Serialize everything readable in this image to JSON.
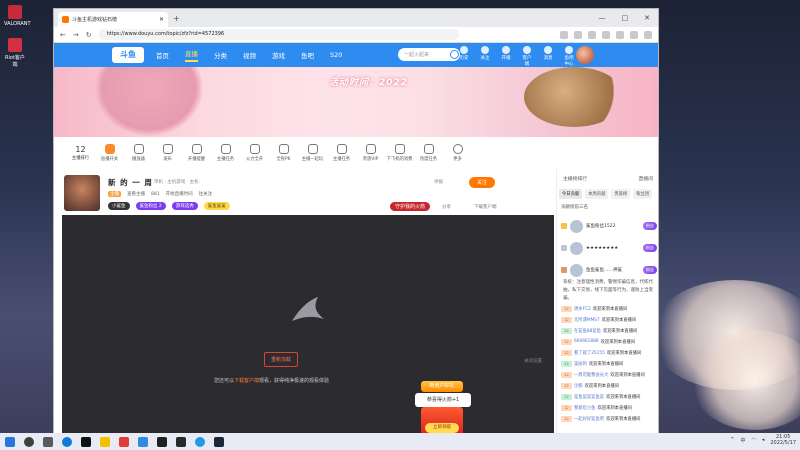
{
  "desktop": {
    "icons": [
      {
        "label": "VALORANT",
        "color": "#c72b3a"
      },
      {
        "label": "Riot客户端",
        "color": "#d23141"
      }
    ]
  },
  "browser": {
    "tab_title": "斗鱼主机游戏钻石榜",
    "url": "https://www.douyu.com/topic/zfz?rid=4572396",
    "window_controls": [
      "—",
      "□",
      "✕"
    ]
  },
  "site": {
    "logo": "斗鱼",
    "nav": [
      "首页",
      "直播",
      "分类",
      "视频",
      "游戏",
      "鱼吧",
      "S20"
    ],
    "active_nav": "直播",
    "search_placeholder": "一起火起来",
    "top_links": [
      "历史",
      "关注",
      "开播",
      "客户端",
      "消息",
      "鱼吧中心"
    ],
    "banner_slogan": "活动时间：2022"
  },
  "toolbar": {
    "rank_number": "12",
    "rank_label": "主播排行",
    "tools": [
      "直播开关",
      "播放器",
      "发布",
      "开播提醒",
      "主播任务",
      "火力全开",
      "全民PK",
      "主播一起玩",
      "主播任务",
      "贵族VIP",
      "下飞机的消费",
      "热度任务",
      "更多"
    ]
  },
  "room": {
    "title": "新 的 一 周",
    "tag": "单机 · 主机游戏 · 主机·",
    "level": "主播",
    "meta": [
      "查看主播",
      "881",
      "开始直播时间",
      "往关注"
    ],
    "chips": [
      "小鲨鱼",
      "鲨鱼粉丝 2",
      "游戏选秀",
      "鲨鱼鲨鲨"
    ],
    "report": "举报",
    "follow": "关注",
    "guard": "守护我的火箭",
    "share": "分享",
    "client": "下载客户端"
  },
  "video": {
    "refresh": "重新加载",
    "message_pre": "您还可以",
    "message_hl": "下载客户端",
    "message_post": "观看，获得纯净极速的观看体验",
    "setting": "关闭设置",
    "gift_banner": "新用户好礼",
    "gift_card": "恭喜得火箭+1",
    "gift_button": "立即领取"
  },
  "side": {
    "header_left": "主播榜排行",
    "header_right": "直播间",
    "tabs": [
      "今日贡献",
      "本周贡献",
      "贵族榜",
      "粉丝团"
    ],
    "rank_title": "贡献榜前三名",
    "ranks": [
      {
        "name": "鲨鱼粉丝1522",
        "badge": "粉丝"
      },
      {
        "name": "★★★★★★★★",
        "badge": "粉丝"
      },
      {
        "name": "鱼鱼鲨鱼……神鲨",
        "badge": "粉丝"
      }
    ],
    "notice": "系统：注意理性消费，警惕诈骗信息，代练代抽，私下交易，线下见面等行为，谨防上当受骗。",
    "chat": [
      {
        "lv": "12",
        "name": "清水FC2",
        "msg": "欢迎来到本直播间"
      },
      {
        "lv": "12",
        "name": "无所谓MMS7",
        "msg": "欢迎来到本直播间"
      },
      {
        "lv": "12",
        "name": "在鲨鱼88鲨鱼",
        "msg": "欢迎来到本直播间"
      },
      {
        "lv": "12",
        "name": "666661888",
        "msg": "欢迎来到本直播间"
      },
      {
        "lv": "12",
        "name": "看了就了35155",
        "msg": "欢迎来到本直播间"
      },
      {
        "lv": "12",
        "name": "美丽的",
        "msg": "欢迎来到本直播间"
      },
      {
        "lv": "12",
        "name": "一周可能我会长大",
        "msg": "欢迎来到本直播间"
      },
      {
        "lv": "12",
        "name": "企鹅",
        "msg": "欢迎来到本直播间"
      },
      {
        "lv": "12",
        "name": "鲨鱼鲨鲨鲨鱼鲨",
        "msg": "欢迎来到本直播间"
      },
      {
        "lv": "12",
        "name": "我爱吃小鱼",
        "msg": "欢迎来到本直播间"
      },
      {
        "lv": "12",
        "name": "一起好好鲨鱼吧",
        "msg": "欢迎来到本直播间"
      }
    ]
  },
  "taskbar": {
    "time": "21:05",
    "date": "2022/5/17",
    "lang": "中"
  }
}
